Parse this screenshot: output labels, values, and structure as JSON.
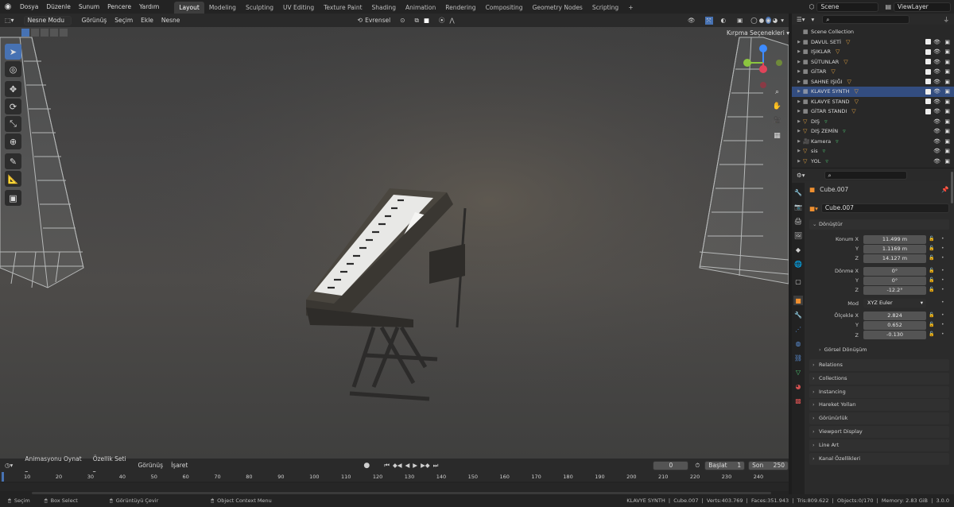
{
  "topbar": {
    "menus": [
      "Dosya",
      "Düzenle",
      "Sunum",
      "Pencere",
      "Yardım"
    ],
    "workspaces": [
      "Layout",
      "Modeling",
      "Sculpting",
      "UV Editing",
      "Texture Paint",
      "Shading",
      "Animation",
      "Rendering",
      "Compositing",
      "Geometry Nodes",
      "Scripting"
    ],
    "active_workspace": "Layout",
    "add_tab": "+",
    "scene": "Scene",
    "view_layer": "ViewLayer"
  },
  "viewport_header": {
    "mode": "Nesne Modu",
    "menus": [
      "Görünüş",
      "Seçim",
      "Ekle",
      "Nesne"
    ],
    "orientation": "Evrensel",
    "clip_options": "Kırpma Seçenekleri"
  },
  "outliner": {
    "root": "Scene Collection",
    "items": [
      {
        "name": "DAVUL SETİ",
        "type": "collection"
      },
      {
        "name": "IŞIKLAR",
        "type": "collection"
      },
      {
        "name": "SÜTUNLAR",
        "type": "collection"
      },
      {
        "name": "GİTAR",
        "type": "collection"
      },
      {
        "name": "SAHNE IŞIĞI",
        "type": "collection"
      },
      {
        "name": "KLAVYE SYNTH",
        "type": "collection",
        "selected": true
      },
      {
        "name": "KLAVYE STAND",
        "type": "collection"
      },
      {
        "name": "GİTAR STANDI",
        "type": "collection"
      },
      {
        "name": "DIŞ",
        "type": "mesh"
      },
      {
        "name": "DIŞ ZEMİN",
        "type": "mesh"
      },
      {
        "name": "Kamera",
        "type": "camera"
      },
      {
        "name": "sis",
        "type": "mesh"
      },
      {
        "name": "YOL",
        "type": "mesh"
      }
    ]
  },
  "properties": {
    "object_name": "Cube.007",
    "object_field": "Cube.007",
    "transform_header": "Dönüştür",
    "location_label": "Konum X",
    "rotation_label": "Dönme X",
    "mode_label": "Mod",
    "scale_label": "Ölçekle X",
    "y_label": "Y",
    "z_label": "Z",
    "location": [
      "11.499 m",
      "1.1169 m",
      "14.127 m"
    ],
    "rotation": [
      "0°",
      "0°",
      "-12.2°"
    ],
    "mode": "XYZ Euler",
    "scale": [
      "2.824",
      "0.652",
      "-0.130"
    ],
    "delta_transform": "Görsel Dönüşüm",
    "sections": [
      "Relations",
      "Collections",
      "Instancing",
      "Hareket Yolları",
      "Görünürlük",
      "Viewport Display",
      "Line Art",
      "Kanal Özellikleri"
    ]
  },
  "timeline": {
    "menus": [
      "Animasyonu Oynat",
      "Özellik Seti",
      "Görünüş",
      "İşaret"
    ],
    "current_frame": "0",
    "start_label": "Başlat",
    "start": "1",
    "end_label": "Son",
    "end": "250",
    "ticks": [
      "10",
      "20",
      "30",
      "40",
      "50",
      "60",
      "70",
      "80",
      "90",
      "100",
      "110",
      "120",
      "130",
      "140",
      "150",
      "160",
      "170",
      "180",
      "190",
      "200",
      "210",
      "220",
      "230",
      "240"
    ]
  },
  "statusbar": {
    "select": "Seçim",
    "box_select": "Box Select",
    "rotate_view": "Görüntüyü Çevir",
    "context_menu": "Object Context Menu",
    "stats": "KLAVYE SYNTH  |  Cube.007  |  Verts:403.769  |  Faces:351.943  |  Tris:809.622  |  Objects:0/170  |  Memory: 2.83 GiB  |  3.0.0"
  },
  "colors": {
    "accent": "#4772b3",
    "selected_row": "#334d80",
    "viewport": "#4a4a4a",
    "gizmo_x": "#e0445a",
    "gizmo_y": "#8cc63f",
    "gizmo_z": "#3d8bff"
  }
}
